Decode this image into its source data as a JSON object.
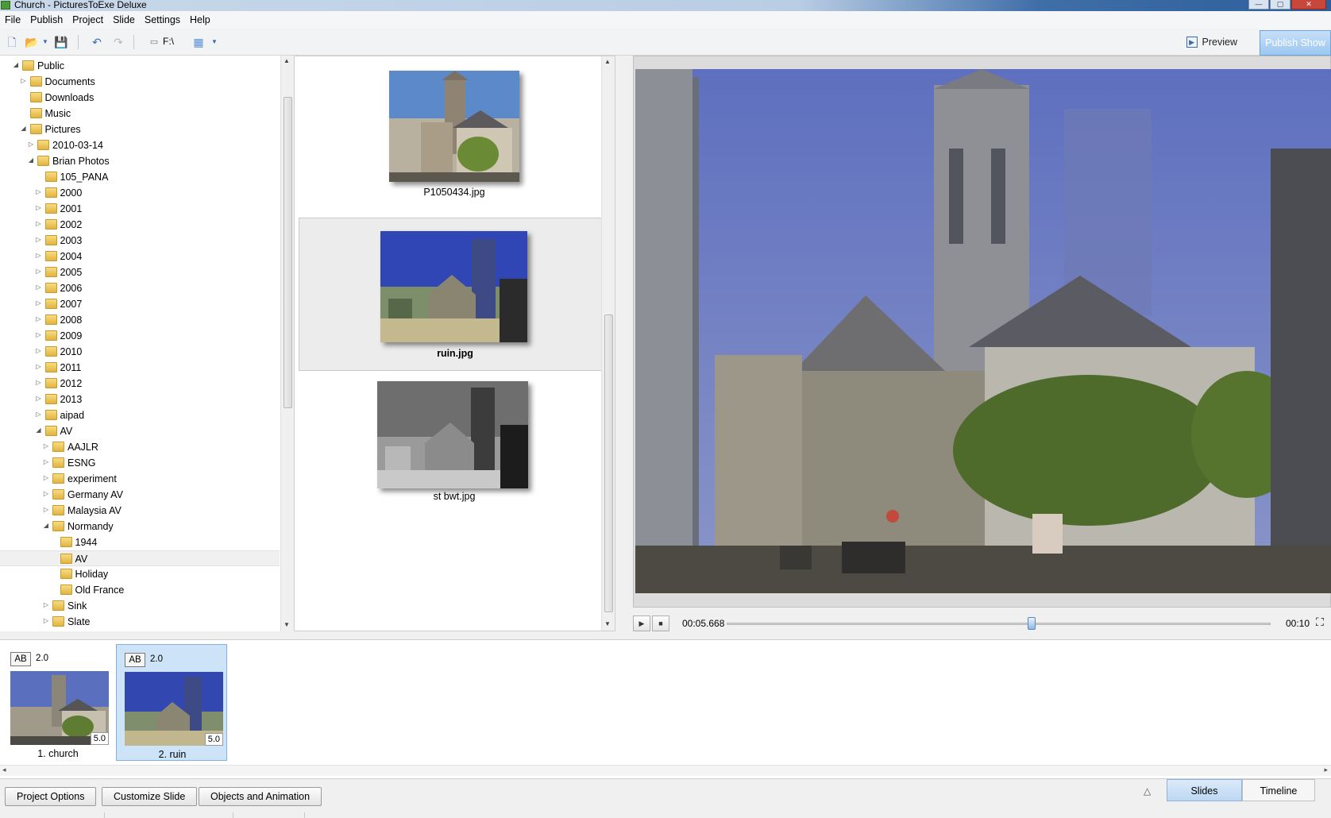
{
  "window": {
    "title": "Church - PicturesToExe Deluxe",
    "buttons": [
      "—",
      "▢",
      "✕"
    ]
  },
  "menu": [
    "File",
    "Publish",
    "Project",
    "Slide",
    "Settings",
    "Help"
  ],
  "toolbar": {
    "drive": "F:\\",
    "preview_label": "Preview",
    "publish_label": "Publish Show"
  },
  "tree": [
    {
      "label": "Public",
      "level": 0,
      "arrow": "expanded"
    },
    {
      "label": "Documents",
      "level": 1,
      "arrow": "collapsed"
    },
    {
      "label": "Downloads",
      "level": 1,
      "arrow": "none"
    },
    {
      "label": "Music",
      "level": 1,
      "arrow": "none"
    },
    {
      "label": "Pictures",
      "level": 1,
      "arrow": "expanded"
    },
    {
      "label": "2010-03-14",
      "level": 2,
      "arrow": "collapsed"
    },
    {
      "label": "Brian Photos",
      "level": 2,
      "arrow": "expanded"
    },
    {
      "label": "105_PANA",
      "level": 3,
      "arrow": "none"
    },
    {
      "label": "2000",
      "level": 3,
      "arrow": "collapsed"
    },
    {
      "label": "2001",
      "level": 3,
      "arrow": "collapsed"
    },
    {
      "label": "2002",
      "level": 3,
      "arrow": "collapsed"
    },
    {
      "label": "2003",
      "level": 3,
      "arrow": "collapsed"
    },
    {
      "label": "2004",
      "level": 3,
      "arrow": "collapsed"
    },
    {
      "label": "2005",
      "level": 3,
      "arrow": "collapsed"
    },
    {
      "label": "2006",
      "level": 3,
      "arrow": "collapsed"
    },
    {
      "label": "2007",
      "level": 3,
      "arrow": "collapsed"
    },
    {
      "label": "2008",
      "level": 3,
      "arrow": "collapsed"
    },
    {
      "label": "2009",
      "level": 3,
      "arrow": "collapsed"
    },
    {
      "label": "2010",
      "level": 3,
      "arrow": "collapsed"
    },
    {
      "label": "2011",
      "level": 3,
      "arrow": "collapsed"
    },
    {
      "label": "2012",
      "level": 3,
      "arrow": "collapsed"
    },
    {
      "label": "2013",
      "level": 3,
      "arrow": "collapsed"
    },
    {
      "label": "aipad",
      "level": 3,
      "arrow": "collapsed"
    },
    {
      "label": "AV",
      "level": 3,
      "arrow": "expanded"
    },
    {
      "label": "AAJLR",
      "level": 4,
      "arrow": "collapsed"
    },
    {
      "label": "ESNG",
      "level": 4,
      "arrow": "collapsed"
    },
    {
      "label": "experiment",
      "level": 4,
      "arrow": "collapsed"
    },
    {
      "label": "Germany AV",
      "level": 4,
      "arrow": "collapsed"
    },
    {
      "label": "Malaysia AV",
      "level": 4,
      "arrow": "collapsed"
    },
    {
      "label": "Normandy",
      "level": 4,
      "arrow": "expanded"
    },
    {
      "label": "1944",
      "level": 5,
      "arrow": "none"
    },
    {
      "label": "AV",
      "level": 5,
      "arrow": "none",
      "selected": true
    },
    {
      "label": "Holiday",
      "level": 5,
      "arrow": "none"
    },
    {
      "label": "Old France",
      "level": 5,
      "arrow": "none"
    },
    {
      "label": "Sink",
      "level": 4,
      "arrow": "collapsed"
    },
    {
      "label": "Slate",
      "level": 4,
      "arrow": "collapsed"
    }
  ],
  "files": [
    {
      "name": "P1050434.jpg",
      "style": "color-church",
      "selected": false
    },
    {
      "name": "ruin.jpg",
      "style": "color-ruin",
      "selected": true
    },
    {
      "name": "st bwt.jpg",
      "style": "bw-ruin",
      "selected": false
    }
  ],
  "playback": {
    "current_time": "00:05.668",
    "total_time": "00:10",
    "progress": 0.56
  },
  "slides": [
    {
      "name": "1. church",
      "transition": "AB",
      "transition_duration": "2.0",
      "duration": "5.0",
      "selected": false
    },
    {
      "name": "2. ruin",
      "transition": "AB",
      "transition_duration": "2.0",
      "duration": "5.0",
      "selected": true
    }
  ],
  "bottom": {
    "buttons": [
      "Project Options",
      "Customize Slide",
      "Objects and Animation"
    ],
    "tabs": [
      {
        "label": "Slides",
        "active": true
      },
      {
        "label": "Timeline",
        "active": false
      }
    ],
    "toggle_icon": "△"
  },
  "colors": {
    "accent": "#9cc7f0",
    "selection": "#cde3f8",
    "folder": "#e2b43e"
  }
}
